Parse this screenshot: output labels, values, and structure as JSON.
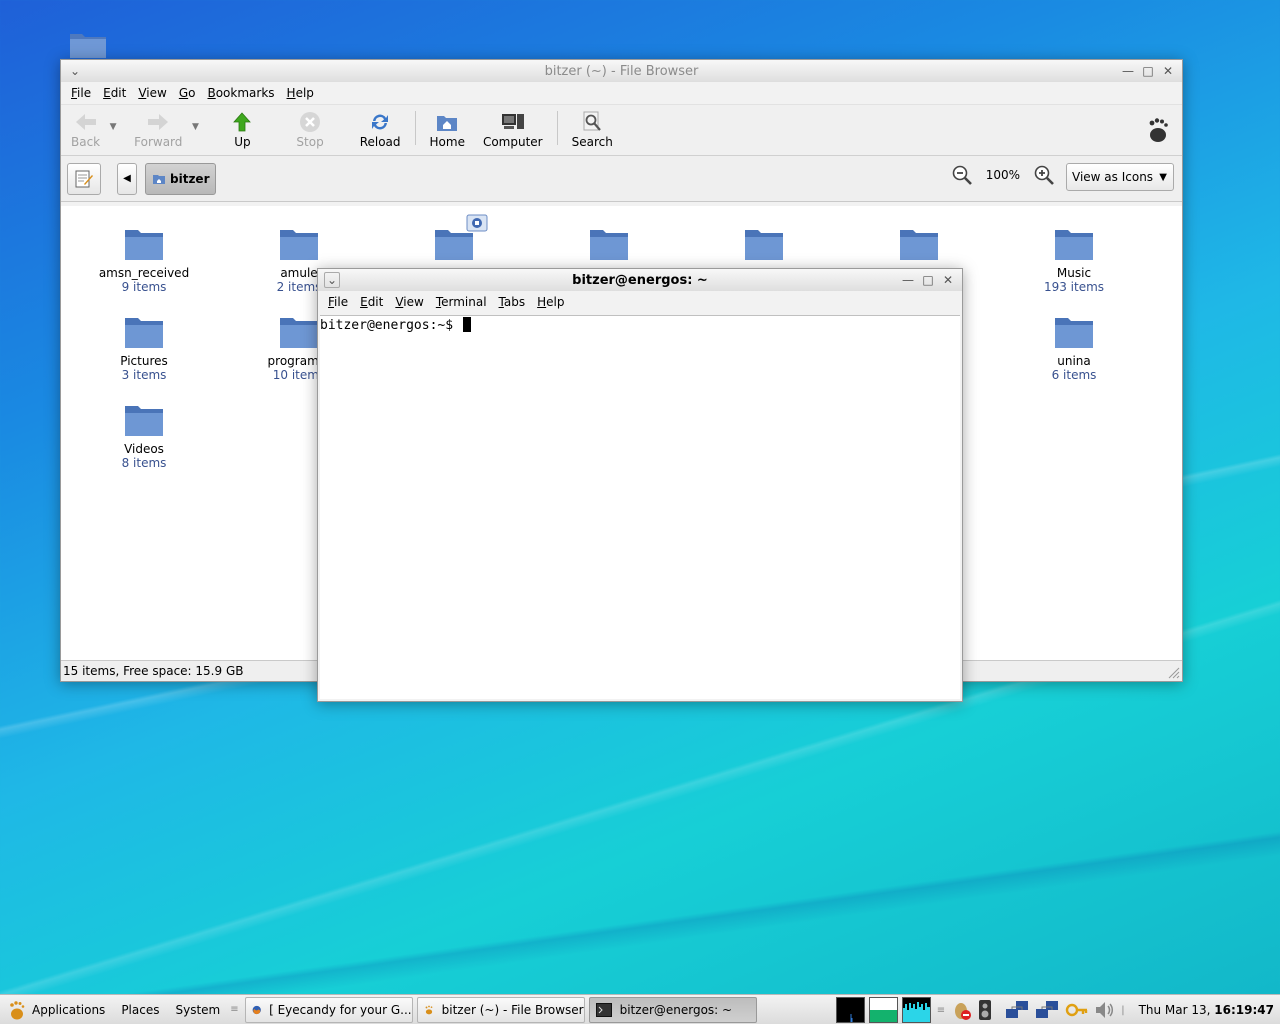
{
  "file_browser": {
    "title": "bitzer (~) - File Browser",
    "menu": [
      "File",
      "Edit",
      "View",
      "Go",
      "Bookmarks",
      "Help"
    ],
    "toolbar": {
      "back": "Back",
      "forward": "Forward",
      "up": "Up",
      "stop": "Stop",
      "reload": "Reload",
      "home": "Home",
      "computer": "Computer",
      "search": "Search"
    },
    "location": {
      "crumb": "bitzer",
      "zoom": "100%",
      "view_mode": "View as Icons"
    },
    "items": [
      {
        "name": "amsn_received",
        "count": "9 items"
      },
      {
        "name": "amule",
        "count": "2 items"
      },
      {
        "name": "",
        "count": ""
      },
      {
        "name": "",
        "count": ""
      },
      {
        "name": "",
        "count": ""
      },
      {
        "name": "",
        "count": ""
      },
      {
        "name": "Music",
        "count": "193 items"
      },
      {
        "name": "Pictures",
        "count": "3 items"
      },
      {
        "name": "programm",
        "count": "10 items"
      },
      {
        "name": "unina",
        "count": "6 items"
      },
      {
        "name": "Videos",
        "count": "8 items"
      }
    ],
    "status": "15 items, Free space: 15.9 GB"
  },
  "terminal": {
    "title": "bitzer@energos: ~",
    "menu": [
      "File",
      "Edit",
      "View",
      "Terminal",
      "Tabs",
      "Help"
    ],
    "prompt": "bitzer@energos:~$"
  },
  "panel": {
    "applications": "Applications",
    "places": "Places",
    "system": "System",
    "tasks": [
      {
        "label": "[ Eyecandy for your G...",
        "icon": "firefox-icon"
      },
      {
        "label": "bitzer (~) - File Browser",
        "icon": "file-browser-icon"
      },
      {
        "label": "bitzer@energos: ~",
        "icon": "terminal-icon"
      }
    ],
    "clock_date": "Thu Mar 13,",
    "clock_time": "16:19:47"
  },
  "colors": {
    "folder_blue": "#5d86c6",
    "count_text": "#38518f"
  }
}
